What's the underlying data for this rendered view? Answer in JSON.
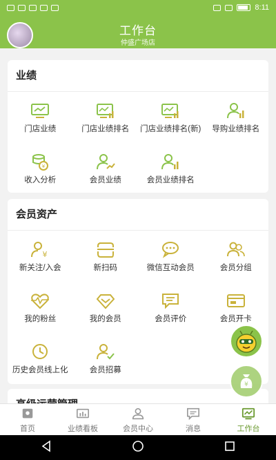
{
  "status": {
    "time": "8:11"
  },
  "header": {
    "title": "工作台",
    "subtitle": "仲盛广场店"
  },
  "colors": {
    "accent": "#8bc34a",
    "icon": "#c9b23a",
    "icon_green": "#8bc34a"
  },
  "sections": [
    {
      "title": "业绩",
      "items": [
        {
          "label": "门店业绩",
          "icon": "monitor-chart-icon"
        },
        {
          "label": "门店业绩排名",
          "icon": "monitor-bars-icon"
        },
        {
          "label": "门店业绩排名(新)",
          "icon": "monitor-bars-icon"
        },
        {
          "label": "导购业绩排名",
          "icon": "person-bars-icon"
        },
        {
          "label": "收入分析",
          "icon": "coins-icon"
        },
        {
          "label": "会员业绩",
          "icon": "person-chart-icon"
        },
        {
          "label": "会员业绩排名",
          "icon": "person-bars-icon"
        }
      ]
    },
    {
      "title": "会员资产",
      "items": [
        {
          "label": "新关注/入会",
          "icon": "person-yen-icon"
        },
        {
          "label": "新扫码",
          "icon": "scan-icon"
        },
        {
          "label": "微信互动会员",
          "icon": "chat-bubbles-icon"
        },
        {
          "label": "会员分组",
          "icon": "group-icon"
        },
        {
          "label": "我的粉丝",
          "icon": "heart-pulse-icon"
        },
        {
          "label": "我的会员",
          "icon": "diamond-icon"
        },
        {
          "label": "会员评价",
          "icon": "comment-icon"
        },
        {
          "label": "会员开卡",
          "icon": "card-icon"
        },
        {
          "label": "历史会员线上化",
          "icon": "clock-icon"
        },
        {
          "label": "会员招募",
          "icon": "person-check-icon"
        }
      ]
    },
    {
      "title": "高级运营管理"
    }
  ],
  "tabs": [
    {
      "label": "首页",
      "icon": "home-icon"
    },
    {
      "label": "业绩看板",
      "icon": "dashboard-icon"
    },
    {
      "label": "会员中心",
      "icon": "user-icon"
    },
    {
      "label": "消息",
      "icon": "message-icon"
    },
    {
      "label": "工作台",
      "icon": "workbench-icon",
      "active": true
    }
  ]
}
